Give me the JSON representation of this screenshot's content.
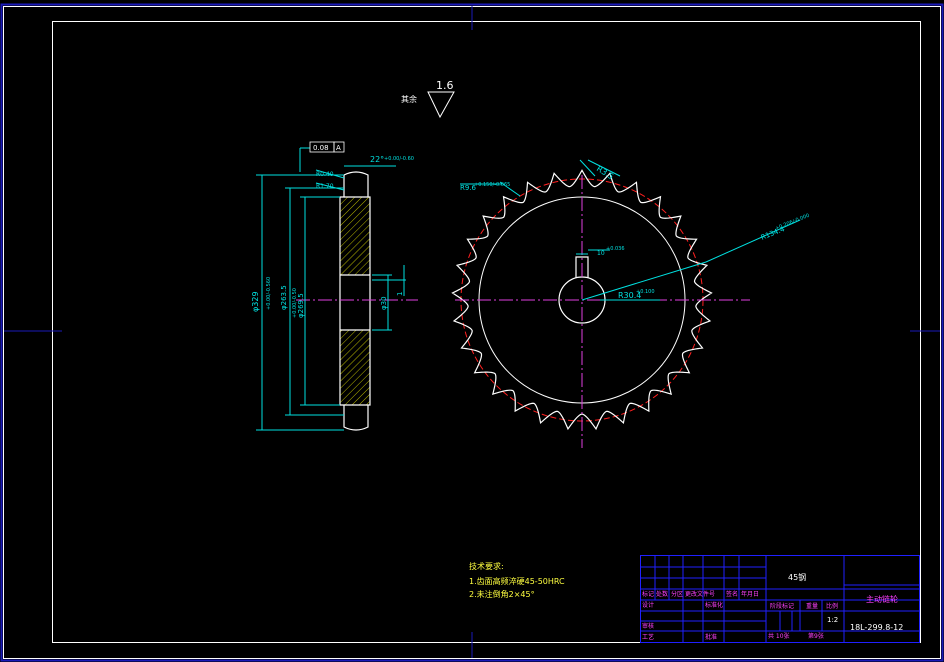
{
  "sheet": {
    "roughness_prefix": "其余",
    "roughness_value": "1.6"
  },
  "side_view": {
    "tol_frame_a": "0.08",
    "tol_frame_b": "A",
    "dim_chamfer_top": "22°",
    "dim_chamfer_tol": "+0.00/-0.60",
    "dim_r_a": "R0.40",
    "dim_r_b": "R1.70",
    "dim_outer_dia": "φ329",
    "dim_root_dia": "φ263.5",
    "dim_root_tol": "+0.00/-0.560",
    "dim_hub_dia": "φ269.5",
    "dim_hub_tol": "+0.00/-0.50",
    "dim_bore": "φ30",
    "dim_key": "1"
  },
  "front_view": {
    "dim_tooth_r": "R3.5",
    "dim_seat_r": "R9.6",
    "dim_seat_tol": "+0.150/-0.065",
    "dim_keyway": "10",
    "dim_keyway_tol": "+0.036",
    "dim_bore_r": "R30.4",
    "dim_bore_tol": "+0.100",
    "dim_outer_r": "R134.4",
    "dim_outer_tol": "+0.206/-0.000"
  },
  "notes": {
    "heading": "技术要求:",
    "line1": "1.齿面高频淬硬45-50HRC",
    "line2": "2.未注倒角2×45°"
  },
  "title_block": {
    "material": "45钢",
    "part_name": "主动链轮",
    "drawing_no": "18L-299.8-12",
    "scale": "1:2",
    "mark_label": "标记",
    "count_label": "处数",
    "zone_label": "分区",
    "change_doc_label": "更改文件号",
    "signature_label": "签名",
    "date_label": "年月日",
    "designer_label": "设计",
    "standardize_label": "标准化",
    "stage_label": "阶段标记",
    "weight_label": "重量",
    "scale_label": "比例",
    "review_label": "审核",
    "process_label": "工艺",
    "approve_label": "批准",
    "sheets_total": "共 10张",
    "sheet_no": "第9张"
  },
  "colors": {
    "frame": "#ffffff",
    "border": "#1a1ab8",
    "gear": "#ffffff",
    "dimension": "#00e0e0",
    "centerline": "#e040e0",
    "pitch_circle": "#ff2020",
    "hatch": "#e8e800",
    "title_lines": "#2020ff",
    "label_magenta": "#ff40ff",
    "text_yellow": "#ffff40",
    "text_white": "#ffffff"
  }
}
